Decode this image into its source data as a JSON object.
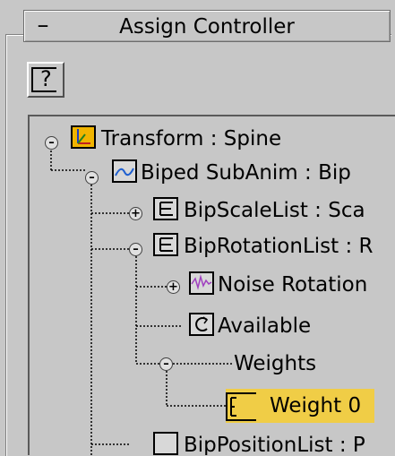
{
  "rollout": {
    "title": "Assign Controller",
    "collapse_symbol": "–"
  },
  "help_button": {
    "glyph": "?",
    "icon": "help-icon"
  },
  "tree": {
    "nodes": [
      {
        "label": "Transform : Spine",
        "icon": "transform-controller-icon",
        "expander": "–"
      },
      {
        "label": "Biped SubAnim  : Bip",
        "icon": "curve-controller-icon",
        "expander": "–"
      },
      {
        "label": "BipScaleList : Sca",
        "icon": "list-controller-icon",
        "expander": "+"
      },
      {
        "label": "BipRotationList : R",
        "icon": "list-controller-icon",
        "expander": "–"
      },
      {
        "label": "Noise Rotation",
        "icon": "noise-controller-icon",
        "expander": "+"
      },
      {
        "label": "Available",
        "icon": "available-icon",
        "expander": ""
      },
      {
        "label": "Weights",
        "icon": "",
        "expander": "–"
      },
      {
        "label": "Weight 0",
        "icon": "weight-controller-icon",
        "expander": "",
        "selected": true
      },
      {
        "label": "BipPositionList : P",
        "icon": "list-controller-icon",
        "expander": "+"
      }
    ]
  },
  "colors": {
    "panel_bg": "#c7c7c7",
    "selection": "#f0cd46",
    "transform_icon_bg": "#f0b400",
    "curve_blue": "#2060d0",
    "noise_purple": "#a040c0"
  }
}
